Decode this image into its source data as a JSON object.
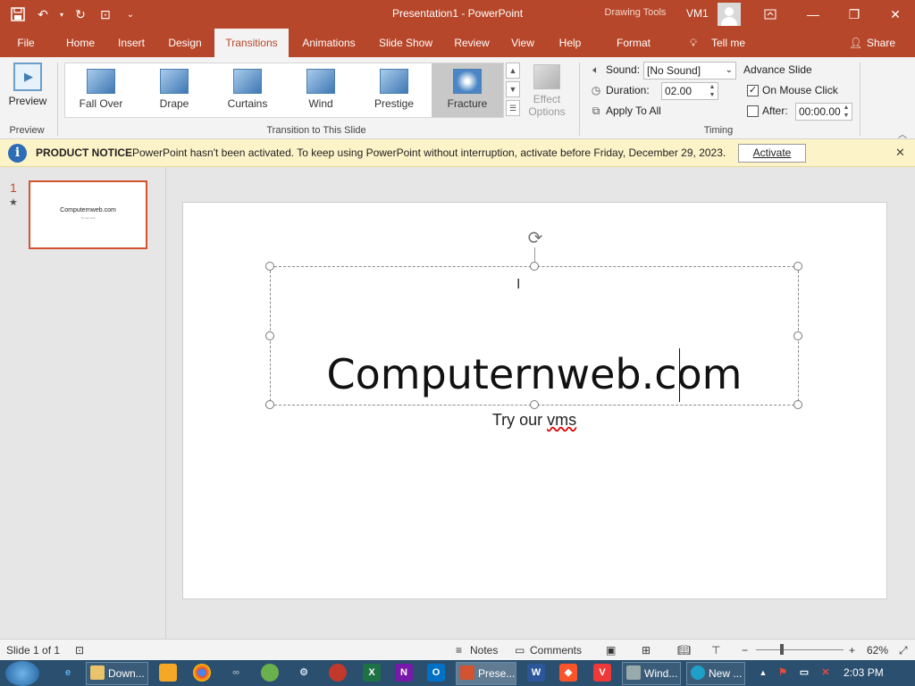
{
  "titlebar": {
    "title": "Presentation1  -  PowerPoint",
    "drawing_tools": "Drawing Tools",
    "user": "VM1"
  },
  "tabs": [
    {
      "label": "File"
    },
    {
      "label": "Home"
    },
    {
      "label": "Insert"
    },
    {
      "label": "Design"
    },
    {
      "label": "Transitions",
      "active": true
    },
    {
      "label": "Animations"
    },
    {
      "label": "Slide Show"
    },
    {
      "label": "Review"
    },
    {
      "label": "View"
    },
    {
      "label": "Help"
    },
    {
      "label": "Format"
    },
    {
      "label": "Tell me"
    },
    {
      "label": "Share"
    }
  ],
  "ribbon": {
    "preview": {
      "button": "Preview",
      "group": "Preview"
    },
    "transitions": {
      "items": [
        "Fall Over",
        "Drape",
        "Curtains",
        "Wind",
        "Prestige",
        "Fracture"
      ],
      "selected": "Fracture",
      "effect_options": [
        "Effect",
        "Options"
      ],
      "group": "Transition to This Slide"
    },
    "timing": {
      "sound_label": "Sound:",
      "sound_value": "[No Sound]",
      "duration_label": "Duration:",
      "duration_value": "02.00",
      "apply_all": "Apply To All",
      "advance_label": "Advance Slide",
      "on_mouse_click": "On Mouse Click",
      "on_mouse_click_checked": true,
      "after_label": "After:",
      "after_value": "00:00.00",
      "after_checked": false,
      "group": "Timing"
    }
  },
  "notice": {
    "heading": "PRODUCT NOTICE",
    "message": "PowerPoint hasn't been activated. To keep using PowerPoint without interruption, activate before Friday, December 29, 2023.",
    "button": "Activate"
  },
  "thumbnails": {
    "number": "1",
    "title": "Computernweb.com",
    "subtitle": "Try our vms"
  },
  "slide": {
    "title": "Computernweb.com",
    "subtitle_a": "Try our ",
    "subtitle_b": "vms"
  },
  "statusbar": {
    "slide_info": "Slide 1 of 1",
    "notes": "Notes",
    "comments": "Comments",
    "zoom": "62%"
  },
  "taskbar": {
    "downloads": "Down...",
    "powerpoint": "Prese...",
    "windows": "Wind...",
    "edge": "New ...",
    "time": "2:03 PM"
  },
  "colors": {
    "accent": "#b7472a",
    "notice_bg": "#fdf3c8",
    "taskbar": "#2b4f6e"
  }
}
